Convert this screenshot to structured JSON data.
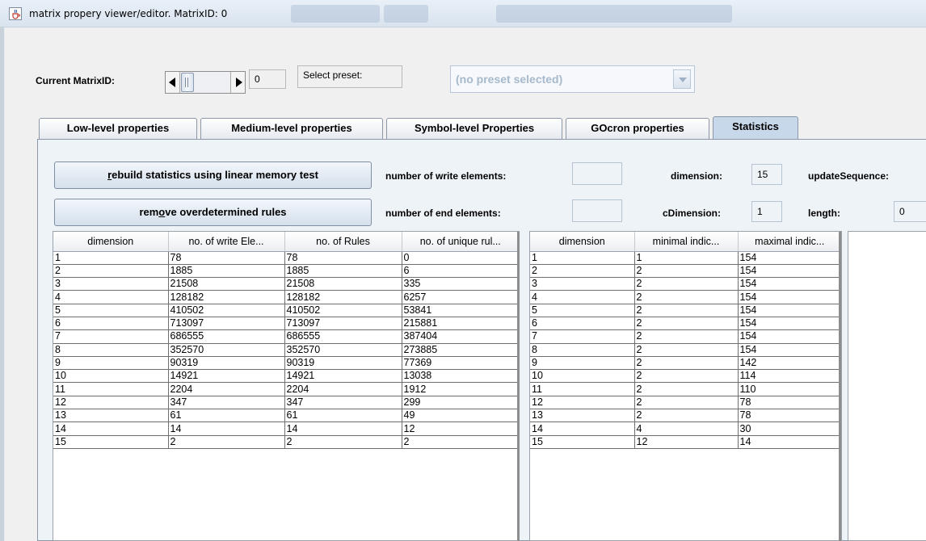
{
  "window": {
    "title": "matrix propery viewer/editor. MatrixID: 0",
    "icon": "java-cup-icon"
  },
  "top": {
    "matrix_label": "Current MatrixID:",
    "matrix_value": "0",
    "preset_label": "Select preset:",
    "preset_combo": "(no preset selected)"
  },
  "tabs": [
    {
      "label": "Low-level properties",
      "active": false
    },
    {
      "label": "Medium-level properties",
      "active": false
    },
    {
      "label": "Symbol-level Properties",
      "active": false
    },
    {
      "label": "GOcron properties",
      "active": false
    },
    {
      "label": "Statistics",
      "active": true
    }
  ],
  "stats": {
    "rebuild_btn": "rebuild statistics using linear memory test",
    "remove_btn": "remove overdetermined rules",
    "write_label": "number of write elements:",
    "end_label": "number of end elements:",
    "dimension_label": "dimension:",
    "dimension_value": "15",
    "cdimension_label": "cDimension:",
    "cdimension_value": "1",
    "update_label": "updateSequence:",
    "length_label": "length:",
    "length_value": "0"
  },
  "table1": {
    "headers": [
      "dimension",
      "no. of write Ele...",
      "no. of Rules",
      "no. of unique rul..."
    ],
    "rows": [
      [
        "1",
        "78",
        "78",
        "0"
      ],
      [
        "2",
        "1885",
        "1885",
        "6"
      ],
      [
        "3",
        "21508",
        "21508",
        "335"
      ],
      [
        "4",
        "128182",
        "128182",
        "6257"
      ],
      [
        "5",
        "410502",
        "410502",
        "53841"
      ],
      [
        "6",
        "713097",
        "713097",
        "215881"
      ],
      [
        "7",
        "686555",
        "686555",
        "387404"
      ],
      [
        "8",
        "352570",
        "352570",
        "273885"
      ],
      [
        "9",
        "90319",
        "90319",
        "77369"
      ],
      [
        "10",
        "14921",
        "14921",
        "13038"
      ],
      [
        "11",
        "2204",
        "2204",
        "1912"
      ],
      [
        "12",
        "347",
        "347",
        "299"
      ],
      [
        "13",
        "61",
        "61",
        "49"
      ],
      [
        "14",
        "14",
        "14",
        "12"
      ],
      [
        "15",
        "2",
        "2",
        "2"
      ]
    ]
  },
  "table2": {
    "headers": [
      "dimension",
      "minimal indic...",
      "maximal indic..."
    ],
    "rows": [
      [
        "1",
        "1",
        "154"
      ],
      [
        "2",
        "2",
        "154"
      ],
      [
        "3",
        "2",
        "154"
      ],
      [
        "4",
        "2",
        "154"
      ],
      [
        "5",
        "2",
        "154"
      ],
      [
        "6",
        "2",
        "154"
      ],
      [
        "7",
        "2",
        "154"
      ],
      [
        "8",
        "2",
        "154"
      ],
      [
        "9",
        "2",
        "142"
      ],
      [
        "10",
        "2",
        "114"
      ],
      [
        "11",
        "2",
        "110"
      ],
      [
        "12",
        "2",
        "78"
      ],
      [
        "13",
        "2",
        "78"
      ],
      [
        "14",
        "4",
        "30"
      ],
      [
        "15",
        "12",
        "14"
      ]
    ]
  }
}
